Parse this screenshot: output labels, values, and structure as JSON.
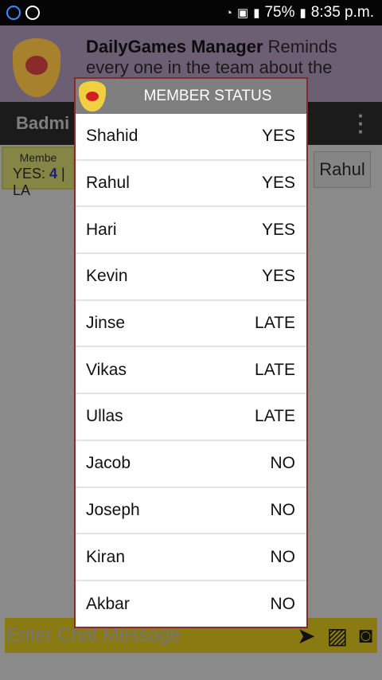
{
  "status_bar": {
    "battery": "75%",
    "time": "8:35 p.m."
  },
  "banner": {
    "app_name": "DailyGames Manager",
    "text": " Reminds every one in the team about the"
  },
  "toolbar": {
    "title": "Badmi"
  },
  "stats": {
    "header": "Membe",
    "yes_label": "YES: ",
    "yes_count": "4",
    "late_label": "LA"
  },
  "member_chip": "Rahul",
  "chat": {
    "placeholder": "Enter Chat Message"
  },
  "dialog": {
    "title": "MEMBER STATUS",
    "members": [
      {
        "name": "Shahid",
        "status": "YES"
      },
      {
        "name": "Rahul",
        "status": "YES"
      },
      {
        "name": "Hari",
        "status": "YES"
      },
      {
        "name": "Kevin",
        "status": "YES"
      },
      {
        "name": "Jinse",
        "status": "LATE"
      },
      {
        "name": "Vikas",
        "status": "LATE"
      },
      {
        "name": "Ullas",
        "status": "LATE"
      },
      {
        "name": "Jacob",
        "status": "NO"
      },
      {
        "name": "Joseph",
        "status": "NO"
      },
      {
        "name": "Kiran",
        "status": "NO"
      },
      {
        "name": "Akbar",
        "status": "NO"
      }
    ]
  }
}
